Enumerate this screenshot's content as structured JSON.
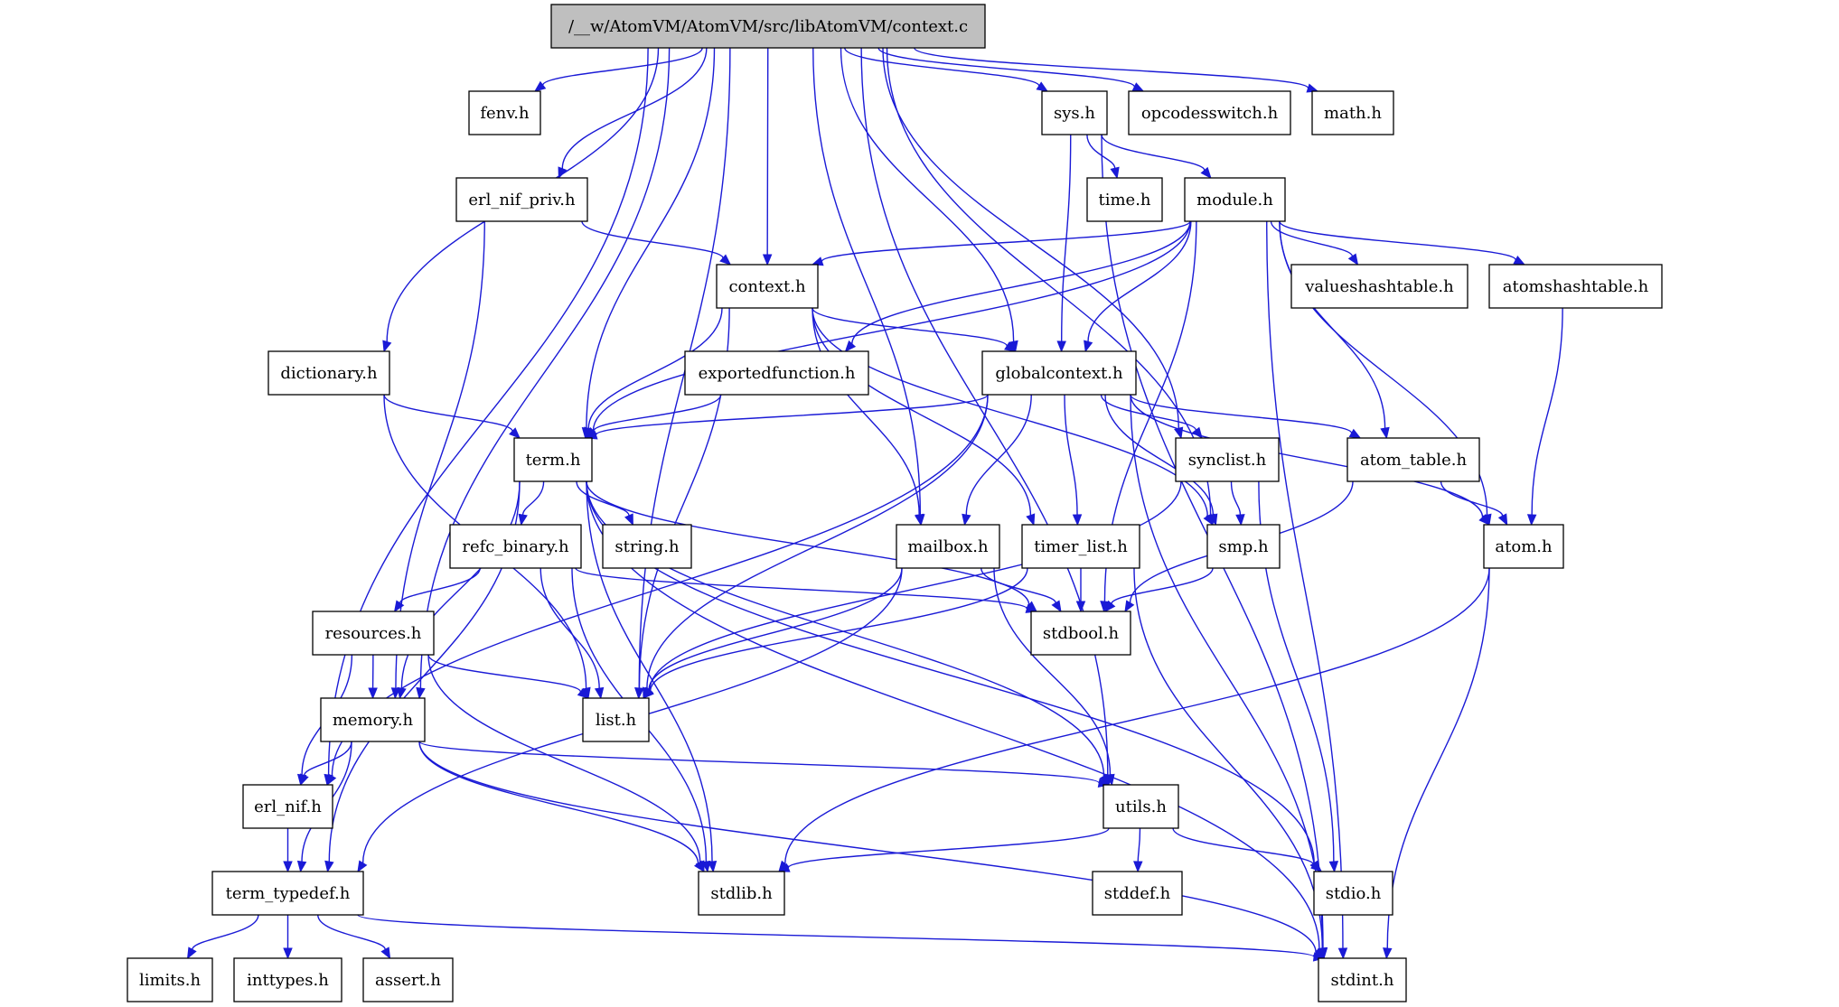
{
  "graph": {
    "title": "/__w/AtomVM/AtomVM/src/libAtomVM/context.c",
    "edge_color": "#1a1ad6",
    "root_fill": "#bfbfbf",
    "nodes": [
      {
        "id": "root",
        "label": "/__w/AtomVM/AtomVM/src/libAtomVM/context.c",
        "root": true
      },
      {
        "id": "fenv",
        "label": "fenv.h"
      },
      {
        "id": "sys",
        "label": "sys.h"
      },
      {
        "id": "opcodesswitch",
        "label": "opcodesswitch.h"
      },
      {
        "id": "math",
        "label": "math.h"
      },
      {
        "id": "erl_nif_priv",
        "label": "erl_nif_priv.h"
      },
      {
        "id": "time",
        "label": "time.h"
      },
      {
        "id": "module",
        "label": "module.h"
      },
      {
        "id": "context_h",
        "label": "context.h"
      },
      {
        "id": "valueshashtable",
        "label": "valueshashtable.h"
      },
      {
        "id": "atomshashtable",
        "label": "atomshashtable.h"
      },
      {
        "id": "dictionary",
        "label": "dictionary.h"
      },
      {
        "id": "exportedfunction",
        "label": "exportedfunction.h"
      },
      {
        "id": "globalcontext",
        "label": "globalcontext.h"
      },
      {
        "id": "term",
        "label": "term.h"
      },
      {
        "id": "synclist",
        "label": "synclist.h"
      },
      {
        "id": "atom_table",
        "label": "atom_table.h"
      },
      {
        "id": "refc_binary",
        "label": "refc_binary.h"
      },
      {
        "id": "string",
        "label": "string.h"
      },
      {
        "id": "mailbox",
        "label": "mailbox.h"
      },
      {
        "id": "timer_list",
        "label": "timer_list.h"
      },
      {
        "id": "smp",
        "label": "smp.h"
      },
      {
        "id": "atom",
        "label": "atom.h"
      },
      {
        "id": "resources",
        "label": "resources.h"
      },
      {
        "id": "stdbool",
        "label": "stdbool.h"
      },
      {
        "id": "memory",
        "label": "memory.h"
      },
      {
        "id": "list",
        "label": "list.h"
      },
      {
        "id": "erl_nif",
        "label": "erl_nif.h"
      },
      {
        "id": "utils",
        "label": "utils.h"
      },
      {
        "id": "term_typedef",
        "label": "term_typedef.h"
      },
      {
        "id": "stdlib",
        "label": "stdlib.h"
      },
      {
        "id": "stddef",
        "label": "stddef.h"
      },
      {
        "id": "stdio",
        "label": "stdio.h"
      },
      {
        "id": "limits",
        "label": "limits.h"
      },
      {
        "id": "inttypes",
        "label": "inttypes.h"
      },
      {
        "id": "assert",
        "label": "assert.h"
      },
      {
        "id": "stdint",
        "label": "stdint.h"
      }
    ],
    "edges": [
      [
        "root",
        "fenv"
      ],
      [
        "root",
        "sys"
      ],
      [
        "root",
        "opcodesswitch"
      ],
      [
        "root",
        "math"
      ],
      [
        "root",
        "erl_nif_priv"
      ],
      [
        "root",
        "context_h"
      ],
      [
        "root",
        "dictionary"
      ],
      [
        "root",
        "globalcontext"
      ],
      [
        "root",
        "term"
      ],
      [
        "root",
        "mailbox"
      ],
      [
        "root",
        "smp"
      ],
      [
        "root",
        "synclist"
      ],
      [
        "root",
        "list"
      ],
      [
        "root",
        "erl_nif"
      ],
      [
        "root",
        "utils"
      ],
      [
        "root",
        "memory"
      ],
      [
        "sys",
        "time"
      ],
      [
        "sys",
        "module"
      ],
      [
        "sys",
        "globalcontext"
      ],
      [
        "sys",
        "stdint"
      ],
      [
        "erl_nif_priv",
        "context_h"
      ],
      [
        "erl_nif_priv",
        "memory"
      ],
      [
        "module",
        "context_h"
      ],
      [
        "module",
        "valueshashtable"
      ],
      [
        "module",
        "atomshashtable"
      ],
      [
        "module",
        "exportedfunction"
      ],
      [
        "module",
        "globalcontext"
      ],
      [
        "module",
        "term"
      ],
      [
        "module",
        "atom_table"
      ],
      [
        "module",
        "atom"
      ],
      [
        "module",
        "stdbool"
      ],
      [
        "module",
        "stdint"
      ],
      [
        "context_h",
        "globalcontext"
      ],
      [
        "context_h",
        "term"
      ],
      [
        "context_h",
        "mailbox"
      ],
      [
        "context_h",
        "timer_list"
      ],
      [
        "context_h",
        "smp"
      ],
      [
        "context_h",
        "list"
      ],
      [
        "atomshashtable",
        "atom"
      ],
      [
        "dictionary",
        "term"
      ],
      [
        "dictionary",
        "list"
      ],
      [
        "exportedfunction",
        "term"
      ],
      [
        "globalcontext",
        "term"
      ],
      [
        "globalcontext",
        "synclist"
      ],
      [
        "globalcontext",
        "atom_table"
      ],
      [
        "globalcontext",
        "atom"
      ],
      [
        "globalcontext",
        "mailbox"
      ],
      [
        "globalcontext",
        "timer_list"
      ],
      [
        "globalcontext",
        "smp"
      ],
      [
        "globalcontext",
        "list"
      ],
      [
        "globalcontext",
        "erl_nif"
      ],
      [
        "globalcontext",
        "stdint"
      ],
      [
        "term",
        "refc_binary"
      ],
      [
        "term",
        "string"
      ],
      [
        "term",
        "memory"
      ],
      [
        "term",
        "utils"
      ],
      [
        "term",
        "stdbool"
      ],
      [
        "term",
        "stdlib"
      ],
      [
        "term",
        "stdio"
      ],
      [
        "term",
        "term_typedef"
      ],
      [
        "term",
        "stdint"
      ],
      [
        "synclist",
        "smp"
      ],
      [
        "synclist",
        "list"
      ],
      [
        "synclist",
        "stdio"
      ],
      [
        "atom_table",
        "atom"
      ],
      [
        "atom_table",
        "stdbool"
      ],
      [
        "refc_binary",
        "resources"
      ],
      [
        "refc_binary",
        "list"
      ],
      [
        "refc_binary",
        "stdlib"
      ],
      [
        "refc_binary",
        "stdbool"
      ],
      [
        "mailbox",
        "list"
      ],
      [
        "mailbox",
        "utils"
      ],
      [
        "mailbox",
        "stdbool"
      ],
      [
        "mailbox",
        "term_typedef"
      ],
      [
        "timer_list",
        "stdbool"
      ],
      [
        "timer_list",
        "list"
      ],
      [
        "timer_list",
        "stdint"
      ],
      [
        "smp",
        "stdbool"
      ],
      [
        "atom",
        "stdlib"
      ],
      [
        "atom",
        "stdint"
      ],
      [
        "resources",
        "memory"
      ],
      [
        "resources",
        "list"
      ],
      [
        "resources",
        "erl_nif"
      ],
      [
        "resources",
        "stdlib"
      ],
      [
        "memory",
        "erl_nif"
      ],
      [
        "memory",
        "term_typedef"
      ],
      [
        "memory",
        "utils"
      ],
      [
        "memory",
        "stdlib"
      ],
      [
        "memory",
        "stdint"
      ],
      [
        "erl_nif",
        "term_typedef"
      ],
      [
        "utils",
        "stddef"
      ],
      [
        "utils",
        "stdio"
      ],
      [
        "utils",
        "stdlib"
      ],
      [
        "term_typedef",
        "limits"
      ],
      [
        "term_typedef",
        "inttypes"
      ],
      [
        "term_typedef",
        "assert"
      ],
      [
        "term_typedef",
        "stdint"
      ]
    ]
  }
}
